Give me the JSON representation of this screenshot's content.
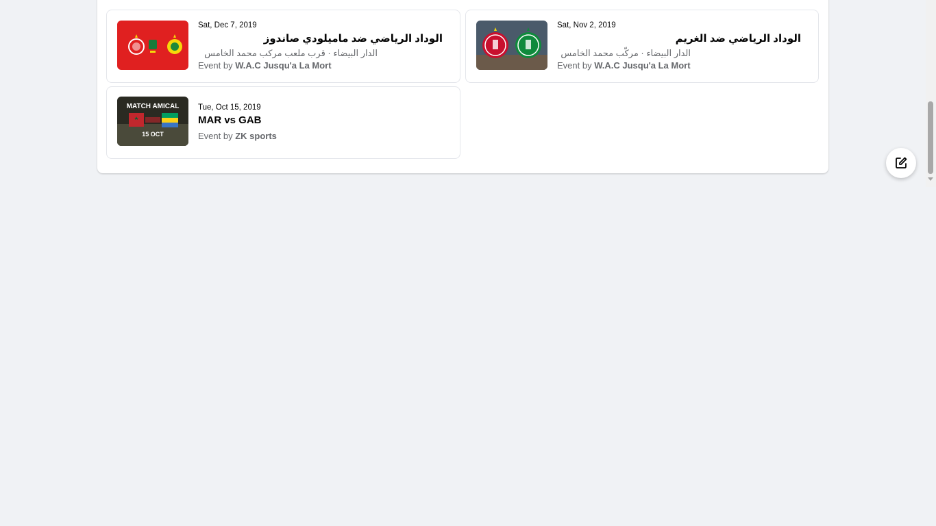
{
  "events": [
    {
      "date": "Sat, Dec 7, 2019",
      "title": "الوداد الرياضي ضد ماميلودي صاندوز",
      "location": "الدار البيضاء · قرب ملعب مركب محمد الخامس",
      "host_prefix": "Event by",
      "host": "W.A.C Jusqu'a La Mort"
    },
    {
      "date": "Sat, Nov 2, 2019",
      "title": "الوداد الرياضي ضد الغريم",
      "location": "الدار البيضاء · مركّب محمد الخامس",
      "host_prefix": "Event by",
      "host": "W.A.C Jusqu'a La Mort"
    },
    {
      "date": "Tue, Oct 15, 2019",
      "title": "MAR vs GAB",
      "thumb_text_top": "MATCH AMICAL",
      "thumb_text_bottom": "15 OCT",
      "host_prefix": "Event by",
      "host": "ZK sports"
    }
  ],
  "icons": {
    "fab": "compose-icon"
  },
  "colors": {
    "wydad_red": "#e02020",
    "page_bg": "#f0f2f5",
    "secondary_text": "#65676b"
  }
}
